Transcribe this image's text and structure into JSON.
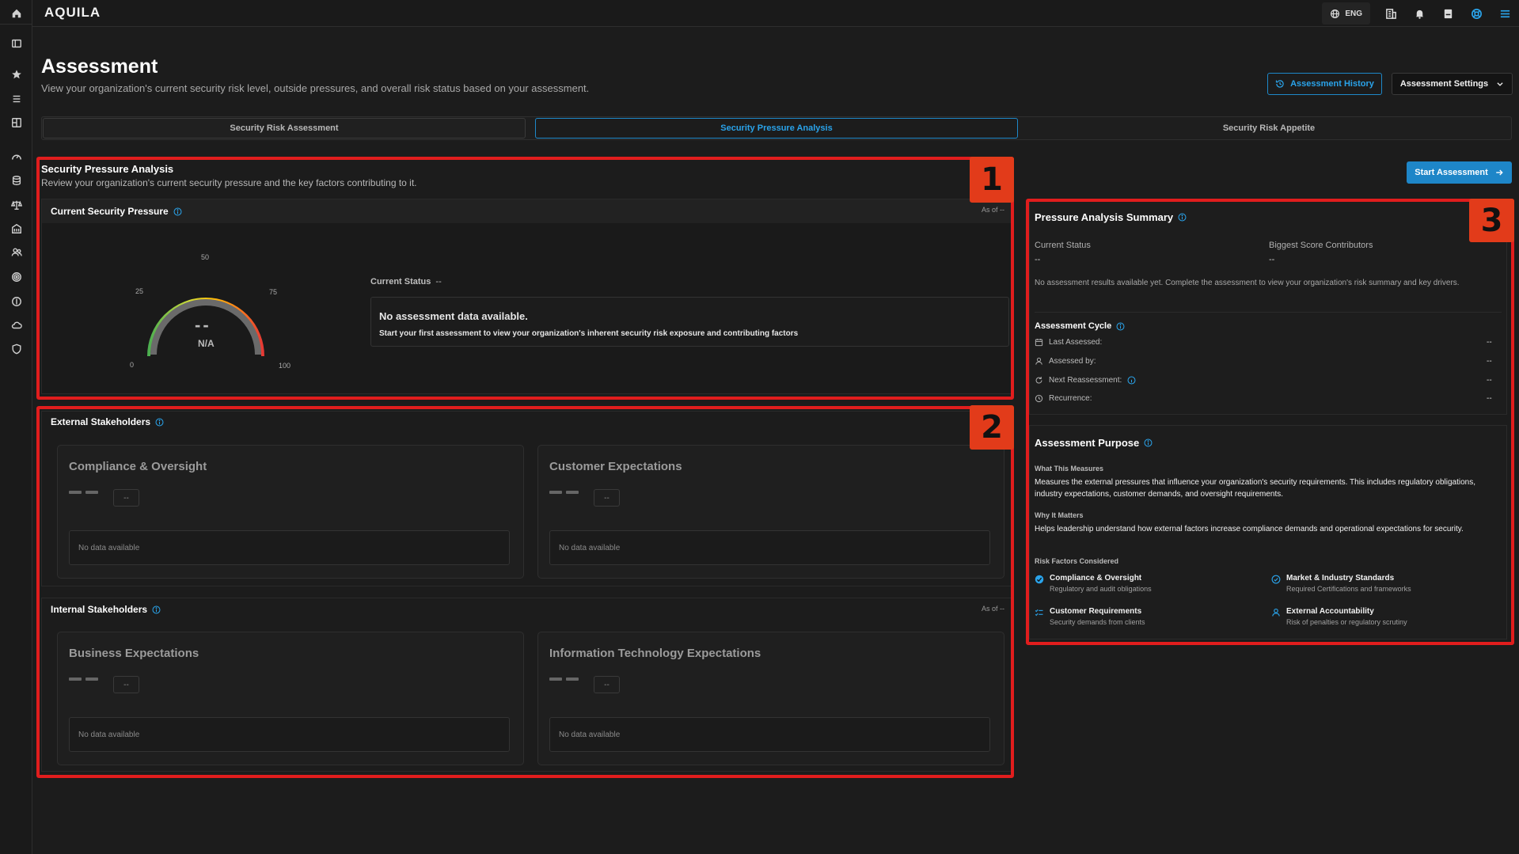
{
  "app": {
    "logo": "AQUILA",
    "lang": "ENG"
  },
  "page": {
    "title": "Assessment",
    "subtitle": "View your organization's current security risk level, outside pressures, and overall risk status based on your assessment.",
    "history_btn": "Assessment History",
    "settings_btn": "Assessment Settings"
  },
  "tabs": [
    {
      "label": "Security Risk Assessment"
    },
    {
      "label": "Security Pressure Analysis"
    },
    {
      "label": "Security Risk Appetite"
    }
  ],
  "annotations": [
    "1",
    "2",
    "3"
  ],
  "pressure": {
    "title": "Security Pressure Analysis",
    "subtitle": "Review your organization's current security pressure and the key factors contributing to it.",
    "card_title": "Current Security Pressure",
    "as_of": "As of --",
    "gauge": {
      "t0": "0",
      "t25": "25",
      "t50": "50",
      "t75": "75",
      "t100": "100",
      "value": "--",
      "label": "N/A"
    },
    "status_label": "Current Status",
    "status_value": "--",
    "nodata_title": "No assessment data available.",
    "nodata_sub": "Start your first assessment to view your organization's inherent security risk exposure and contributing factors"
  },
  "external": {
    "title": "External Stakeholders",
    "cards": [
      {
        "title": "Compliance & Oversight",
        "chip": "--",
        "nodata": "No data available"
      },
      {
        "title": "Customer Expectations",
        "chip": "--",
        "nodata": "No data available"
      }
    ]
  },
  "internal": {
    "title": "Internal Stakeholders",
    "as_of": "As of --",
    "cards": [
      {
        "title": "Business Expectations",
        "chip": "--",
        "nodata": "No data available"
      },
      {
        "title": "Information Technology Expectations",
        "chip": "--",
        "nodata": "No data available"
      }
    ]
  },
  "summary": {
    "start_btn": "Start Assessment",
    "title": "Pressure Analysis Summary",
    "current_status_label": "Current Status",
    "current_status_value": "--",
    "contrib_label": "Biggest Score Contributors",
    "contrib_value": "--",
    "message": "No assessment results available yet. Complete the assessment to view your organization's risk summary and key drivers.",
    "cycle_title": "Assessment Cycle",
    "cycle": [
      {
        "label": "Last Assessed:",
        "value": "--"
      },
      {
        "label": "Assessed by:",
        "value": "--"
      },
      {
        "label": "Next Reassessment:",
        "value": "--"
      },
      {
        "label": "Recurrence:",
        "value": "--"
      }
    ]
  },
  "purpose": {
    "title": "Assessment Purpose",
    "what_label": "What This Measures",
    "what_text": "Measures the external pressures that influence your organization's security requirements. This includes regulatory obligations, industry expectations, customer demands, and oversight requirements.",
    "why_label": "Why It Matters",
    "why_text": "Helps leadership understand how external factors increase compliance demands and operational expectations for security.",
    "factors_label": "Risk Factors Considered",
    "factors": [
      {
        "title": "Compliance & Oversight",
        "sub": "Regulatory and audit obligations"
      },
      {
        "title": "Market & Industry Standards",
        "sub": "Required Certifications and frameworks"
      },
      {
        "title": "Customer Requirements",
        "sub": "Security demands from clients"
      },
      {
        "title": "External Accountability",
        "sub": "Risk of penalties or regulatory scrutiny"
      }
    ]
  },
  "colors": {
    "accent": "#1e88c9",
    "annotation": "#e11d1d",
    "background": "#1c1c1c"
  }
}
